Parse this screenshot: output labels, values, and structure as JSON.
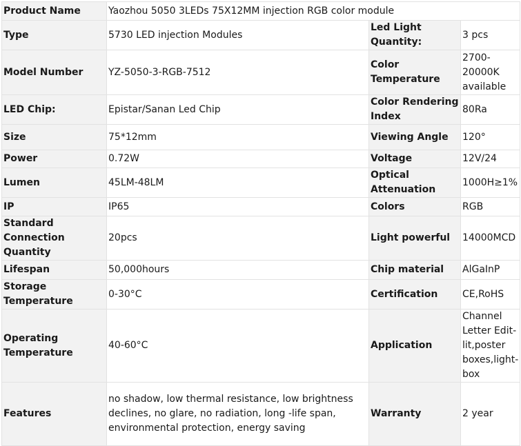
{
  "spec_table": {
    "product_name": {
      "label": "Product Name",
      "value": "Yaozhou 5050 3LEDs 75X12MM injection RGB color module"
    },
    "rows": [
      {
        "label_left": "Type",
        "value_left": "5730 LED injection Modules",
        "label_right": "Led Light Quantity:",
        "value_right": "3 pcs"
      },
      {
        "label_left": "Model Number",
        "value_left": "YZ-5050-3-RGB-7512",
        "label_right": "Color Temperature",
        "value_right": "2700-20000K available"
      },
      {
        "label_left": "LED Chip:",
        "value_left": "Epistar/Sanan Led Chip",
        "label_right": "Color Rendering Index",
        "value_right": "80Ra"
      },
      {
        "label_left": "Size",
        "value_left": "75*12mm",
        "label_right": "Viewing Angle",
        "value_right": "120°"
      },
      {
        "label_left": "Power",
        "value_left": "0.72W",
        "label_right": "Voltage",
        "value_right": "12V/24"
      },
      {
        "label_left": "Lumen",
        "value_left": "45LM-48LM",
        "label_right": "Optical Attenuation",
        "value_right": "1000H≥1%"
      },
      {
        "label_left": "IP",
        "value_left": "IP65",
        "label_right": "Colors",
        "value_right": "RGB"
      },
      {
        "label_left": "Standard Connection Quantity",
        "value_left": "20pcs",
        "label_right": "Light powerful",
        "value_right": "14000MCD"
      },
      {
        "label_left": "Lifespan",
        "value_left": "50,000hours",
        "label_right": "Chip material",
        "value_right": "AlGaInP"
      },
      {
        "label_left": "Storage Temperature",
        "value_left": "0-30°C",
        "label_right": "Certification",
        "value_right": "CE,RoHS"
      },
      {
        "label_left": "Operating Temperature",
        "value_left": "40-60°C",
        "label_right": "Application",
        "value_right": "Channel Letter Edit-lit,poster boxes,light-box"
      },
      {
        "label_left": "Features",
        "value_left": "no shadow, low thermal resistance, low brightness declines, no glare, no radiation, long -life span, environmental protection, energy saving",
        "label_right": "Warranty",
        "value_right": "2 year"
      }
    ]
  }
}
